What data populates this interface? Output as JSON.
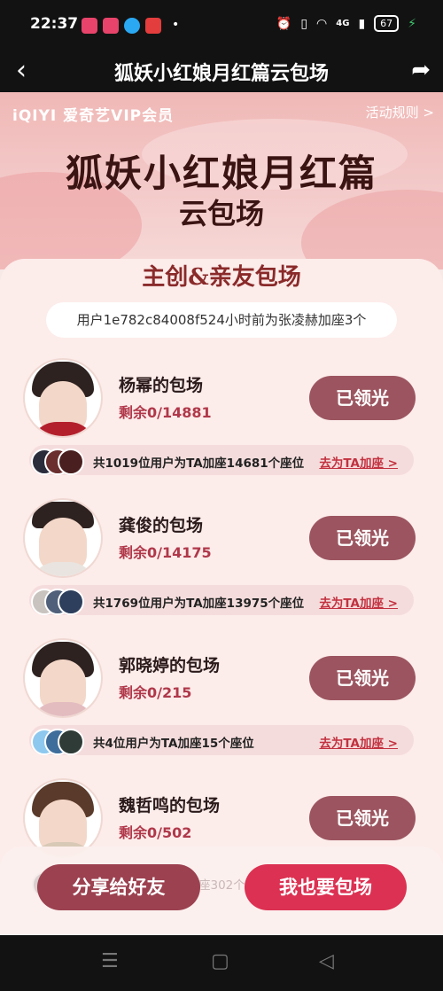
{
  "status_bar": {
    "time": "22:37",
    "battery": "67",
    "network": "4G",
    "app_icons": [
      "#e8436a",
      "#e8436a",
      "#2aa8f2",
      "#e33d3d"
    ]
  },
  "nav": {
    "title": "狐妖小红娘月红篇云包场",
    "back_icon": "chevron-left-icon",
    "share_icon": "share-arrow-icon"
  },
  "banner": {
    "brand": "iQIYI 爱奇艺VIP会员",
    "rules_link": "活动规则 >",
    "calligraphy_title": "狐妖小红娘月红篇",
    "calligraphy_subtitle": "云包场"
  },
  "section_title": "主创&亲友包场",
  "ticker": "用户1e782c84008f524小时前为张凌赫加座3个",
  "rows": [
    {
      "name": "杨幂的包场",
      "remain": "剩余0/14881",
      "button": "已领光",
      "summary": "共1019位用户为TA加座14681个座位",
      "link": "去为TA加座 >"
    },
    {
      "name": "龚俊的包场",
      "remain": "剩余0/14175",
      "button": "已领光",
      "summary": "共1769位用户为TA加座13975个座位",
      "link": "去为TA加座 >"
    },
    {
      "name": "郭晓婷的包场",
      "remain": "剩余0/215",
      "button": "已领光",
      "summary": "共4位用户为TA加座15个座位",
      "link": "去为TA加座 >"
    },
    {
      "name": "魏哲鸣的包场",
      "remain": "剩余0/502",
      "button": "已领光",
      "summary": "",
      "link": ""
    }
  ],
  "peek_text": "座302个",
  "bottom": {
    "share_button": "分享给好友",
    "host_button": "我也要包场"
  },
  "colors": {
    "accent": "#dc3152",
    "button_muted": "#9c5560",
    "remain_red": "#b0384a"
  }
}
